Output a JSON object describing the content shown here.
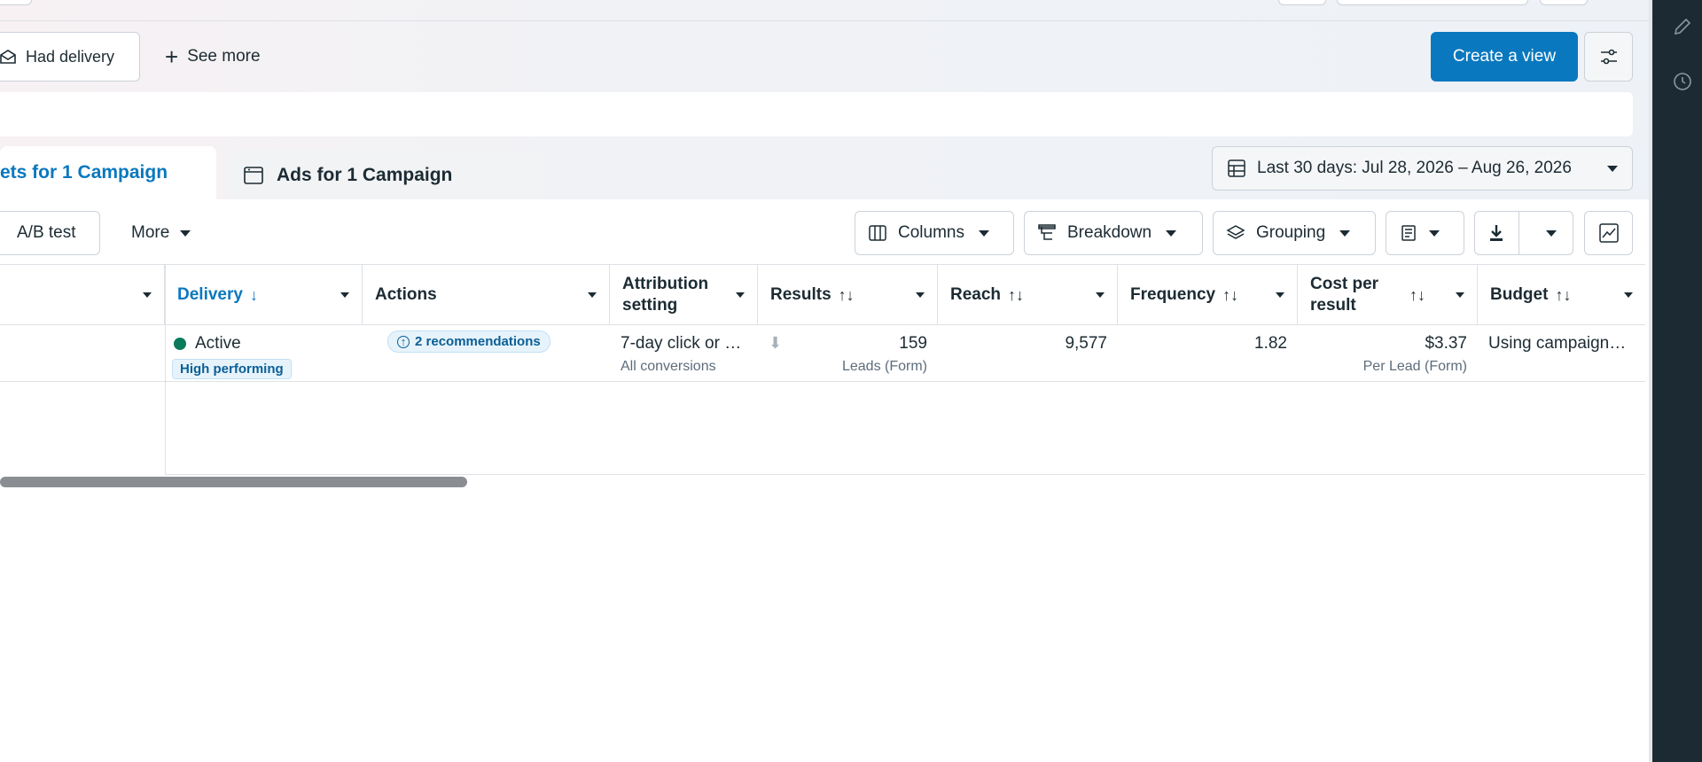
{
  "filters": {
    "had_delivery": "Had delivery",
    "see_more": "See more"
  },
  "header_actions": {
    "create_view": "Create a view"
  },
  "tabs": {
    "adsets_label": "ets for 1 Campaign",
    "ads_label": "Ads for 1 Campaign"
  },
  "date_range": {
    "label": "Last 30 days: Jul 28, 2026 – Aug 26, 2026"
  },
  "toolbar": {
    "ab_test": "A/B test",
    "more": "More",
    "columns": "Columns",
    "breakdown": "Breakdown",
    "grouping": "Grouping"
  },
  "table": {
    "headers": {
      "delivery": "Delivery",
      "delivery_sort": "↓",
      "actions": "Actions",
      "attribution": "Attribution setting",
      "results": "Results",
      "reach": "Reach",
      "frequency": "Frequency",
      "cost_per_result": "Cost per result",
      "budget": "Budget",
      "sort_icon": "↑↓"
    },
    "row": {
      "delivery_status": "Active",
      "delivery_badge": "High performing",
      "recommendations": "2 recommendations",
      "attribution": "7-day click or …",
      "attribution_sub": "All conversions",
      "results": "159",
      "results_sub": "Leads (Form)",
      "reach": "9,577",
      "frequency": "1.82",
      "cost": "$3.37",
      "cost_sub": "Per Lead (Form)",
      "budget": "Using campaign…"
    }
  },
  "colors": {
    "primary": "#0a78be",
    "active_dot": "#0b7a5b",
    "badge_bg": "#e7f3fb",
    "rail": "#1c2b33"
  }
}
